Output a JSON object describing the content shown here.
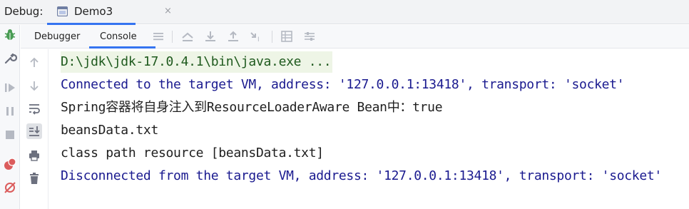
{
  "debug_bar": {
    "label": "Debug:",
    "tab": {
      "title": "Demo3",
      "close": "×"
    }
  },
  "sub_toolbar": {
    "tabs": [
      {
        "label": "Debugger",
        "active": false
      },
      {
        "label": "Console",
        "active": true
      }
    ],
    "icons": [
      "list-icon",
      "show-execution-point-icon",
      "step-over-icon",
      "step-into-icon",
      "step-out-icon",
      "run-to-cursor-icon",
      "evaluate-expression-icon",
      "trace-settings-icon"
    ]
  },
  "left_toolbar": {
    "icons": [
      "debug-bug-icon",
      "settings-wrench-icon",
      "resume-icon",
      "pause-icon",
      "stop-icon",
      "view-breakpoints-icon",
      "mute-breakpoints-icon"
    ]
  },
  "gutter": {
    "icons": [
      "up-arrow-icon",
      "down-arrow-icon",
      "soft-wrap-icon",
      "scroll-to-end-icon",
      "print-icon",
      "clear-all-icon"
    ]
  },
  "console": {
    "lines": [
      {
        "kind": "cmd",
        "text": "D:\\jdk\\jdk-17.0.4.1\\bin\\java.exe ..."
      },
      {
        "kind": "sys",
        "text": "Connected to the target VM, address: '127.0.0.1:13418', transport: 'socket'"
      },
      {
        "kind": "out",
        "text": "Spring容器将自身注入到ResourceLoaderAware Bean中：true"
      },
      {
        "kind": "out",
        "text": "beansData.txt"
      },
      {
        "kind": "out",
        "text": "class path resource [beansData.txt]"
      },
      {
        "kind": "sys",
        "text": "Disconnected from the target VM, address: '127.0.0.1:13418', transport: 'socket'"
      }
    ]
  },
  "colors": {
    "accent": "#3574f0",
    "system_text": "#1a1a8f",
    "command_text": "#1f5a1e",
    "command_bg": "#eef5e6"
  }
}
